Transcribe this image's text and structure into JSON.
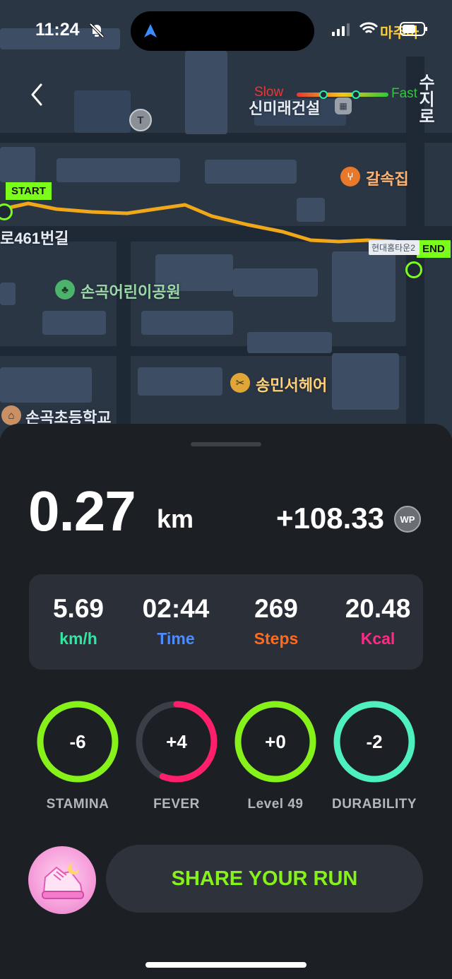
{
  "status_bar": {
    "time": "11:24",
    "carrier_label": "마주마"
  },
  "map": {
    "legend": {
      "slow": "Slow",
      "fast": "Fast"
    },
    "labels": {
      "building": "신미래건설",
      "restaurant": "갈속집",
      "road_left": "로461번길",
      "park": "손곡어린이공원",
      "salon": "송민서헤어",
      "school": "손곡초등학교",
      "apartment": "현대홈타운2",
      "road_right": "수지로"
    },
    "route": {
      "start": "START",
      "end": "END"
    }
  },
  "summary": {
    "distance": "0.27",
    "distance_unit": "km",
    "wp_gain": "+108.33",
    "wp_icon_label": "WP"
  },
  "stats": [
    {
      "value": "5.69",
      "label": "km/h",
      "color": "#2fe7a0"
    },
    {
      "value": "02:44",
      "label": "Time",
      "color": "#4d8cff"
    },
    {
      "value": "269",
      "label": "Steps",
      "color": "#ff6a1f"
    },
    {
      "value": "20.48",
      "label": "Kcal",
      "color": "#ff2a86"
    }
  ],
  "attributes": [
    {
      "value": "-6",
      "label": "STAMINA",
      "color": "#86f21a",
      "fill": 1.0
    },
    {
      "value": "+4",
      "label": "FEVER",
      "color": "#ff1f6b",
      "fill": 0.56
    },
    {
      "value": "+0",
      "label": "Level 49",
      "color": "#86f21a",
      "fill": 1.0
    },
    {
      "value": "-2",
      "label": "DURABILITY",
      "color": "#4ef0c0",
      "fill": 1.0
    }
  ],
  "share_button": {
    "label": "SHARE YOUR RUN"
  }
}
